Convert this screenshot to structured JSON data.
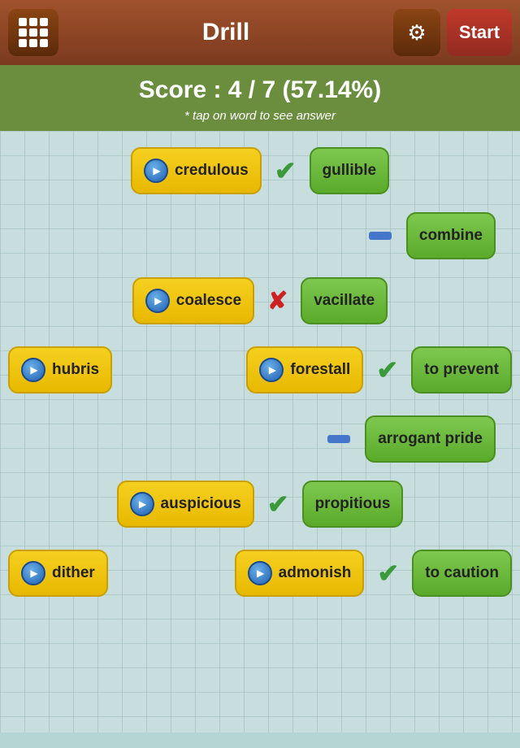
{
  "header": {
    "title": "Drill",
    "start_label": "Start"
  },
  "score": {
    "label": "Score  :  4 / 7 (57.14%)",
    "hint": "* tap on word to see answer"
  },
  "rows": [
    {
      "id": "row1",
      "word": "credulous",
      "answer": "gullible",
      "status": "correct"
    },
    {
      "id": "row2",
      "word": null,
      "answer": "combine",
      "status": "unanswered"
    },
    {
      "id": "row3",
      "word": "coalesce",
      "answer": "vacillate",
      "status": "wrong"
    },
    {
      "id": "row4-left",
      "word": "hubris"
    },
    {
      "id": "row4-right",
      "word": "forestall",
      "answer": "to prevent",
      "status": "correct"
    },
    {
      "id": "row5",
      "word": null,
      "answer": "arrogant pride",
      "status": "unanswered"
    },
    {
      "id": "row6",
      "word": "auspicious",
      "answer": "propitious",
      "status": "correct"
    },
    {
      "id": "row7-left",
      "word": "dither"
    },
    {
      "id": "row7-right",
      "word": "admonish",
      "answer": "to caution",
      "status": "correct"
    }
  ]
}
